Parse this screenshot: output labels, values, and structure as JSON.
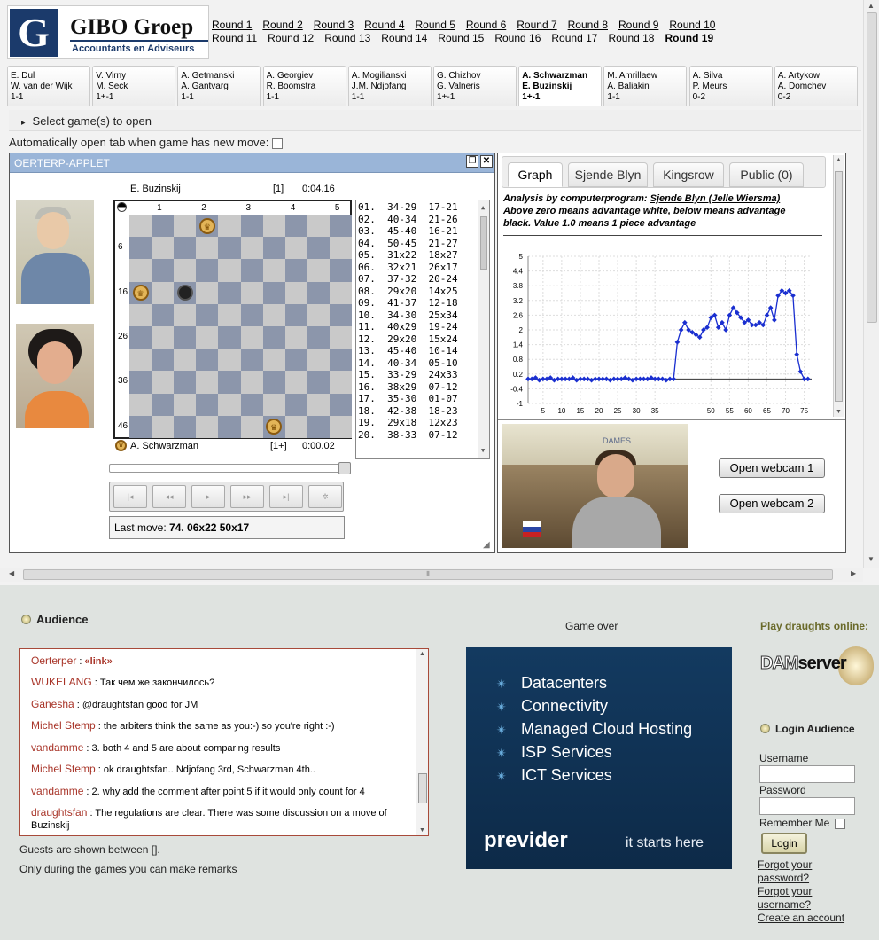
{
  "header": {
    "logo_letter": "G",
    "logo_name": "GIBO Groep",
    "logo_tagline": "Accountants en Adviseurs"
  },
  "rounds": [
    "Round 1",
    "Round 2",
    "Round 3",
    "Round 4",
    "Round 5",
    "Round 6",
    "Round 7",
    "Round 8",
    "Round 9",
    "Round 10",
    "Round 11",
    "Round 12",
    "Round 13",
    "Round 14",
    "Round 15",
    "Round 16",
    "Round 17",
    "Round 18",
    "Round 19"
  ],
  "current_round": "Round 19",
  "game_tabs": [
    {
      "white": "E. Dul",
      "black": "W. van der Wijk",
      "score": "1-1"
    },
    {
      "white": "V. Virny",
      "black": "M. Seck",
      "score": "1+-1"
    },
    {
      "white": "A. Getmanski",
      "black": "A. Gantvarg",
      "score": "1-1"
    },
    {
      "white": "A. Georgiev",
      "black": "R. Boomstra",
      "score": "1-1"
    },
    {
      "white": "A. Mogilianski",
      "black": "J.M. Ndjofang",
      "score": "1-1"
    },
    {
      "white": "G. Chizhov",
      "black": "G. Valneris",
      "score": "1+-1"
    },
    {
      "white": "A. Schwarzman",
      "black": "E. Buzinskij",
      "score": "1+-1"
    },
    {
      "white": "M. Amrillaew",
      "black": "A. Baliakin",
      "score": "1-1"
    },
    {
      "white": "A. Silva",
      "black": "P. Meurs",
      "score": "0-2"
    },
    {
      "white": "A. Artykow",
      "black": "A. Domchev",
      "score": "0-2"
    }
  ],
  "select_games_label": "Select game(s) to open",
  "auto_open_label": "Automatically open tab when game has new move:",
  "applet": {
    "title": "OERTERP-APPLET",
    "top_player": "E. Buzinskij",
    "top_score": "[1]",
    "top_clock": "0:04.16",
    "bottom_player": "A. Schwarzman",
    "bottom_score": "[1+]",
    "bottom_clock": "0:00.02",
    "col_labels": [
      "1",
      "2",
      "3",
      "4",
      "5"
    ],
    "row_labels": [
      "6",
      "16",
      "26",
      "36",
      "46"
    ],
    "moves": [
      "01.  34-29  17-21",
      "02.  40-34  21-26",
      "03.  45-40  16-21",
      "04.  50-45  21-27",
      "05.  31x22  18x27",
      "06.  32x21  26x17",
      "07.  37-32  20-24",
      "08.  29x20  14x25",
      "09.  41-37  12-18",
      "10.  34-30  25x34",
      "11.  40x29  19-24",
      "12.  29x20  15x24",
      "13.  45-40  10-14",
      "14.  40-34  05-10",
      "15.  33-29  24x33",
      "16.  38x29  07-12",
      "17.  35-30  01-07",
      "18.  42-38  18-23",
      "19.  29x18  12x23",
      "20.  38-33  07-12"
    ],
    "last_move_label": "Last move: ",
    "last_move_value": "74. 06x22 50x17",
    "pieces": [
      {
        "square": 2,
        "color": "white",
        "king": true
      },
      {
        "square": 16,
        "color": "white",
        "king": true
      },
      {
        "square": 17,
        "color": "black",
        "king": false
      },
      {
        "square": 49,
        "color": "white",
        "king": true
      }
    ],
    "controls": [
      "first-icon",
      "prev-icon",
      "play-icon",
      "next-icon",
      "last-icon",
      "settings-icon"
    ],
    "control_glyphs": [
      "|◂",
      "◂◂",
      "▸",
      "▸▸",
      "▸|",
      "✲"
    ]
  },
  "right_tabs": [
    "Graph",
    "Sjende Blyn",
    "Kingsrow",
    "Public (0)"
  ],
  "analysis": {
    "prefix": "Analysis by computerprogram: ",
    "program_link": "Sjende Blyn (Jelle Wiersma)",
    "line2": "Above zero means advantage white, below means advantage",
    "line3": "black. Value 1.0 means 1 piece advantage"
  },
  "webcam_buttons": [
    "Open webcam 1",
    "Open webcam 2"
  ],
  "webcam_photo_banner": "DAMES",
  "audience": {
    "title": "Audience",
    "messages": [
      {
        "user": "Oerterper",
        "text": "«link»",
        "is_link": true
      },
      {
        "user": "WUKELANG",
        "text": "Так чем же закончилось?"
      },
      {
        "user": "Ganesha",
        "text": "@draughtsfan good for JM"
      },
      {
        "user": "Michel Stemp",
        "text": "the arbiters think the same as you:-) so you're right :-)"
      },
      {
        "user": "vandamme",
        "text": "3. both 4 and 5 are about comparing results"
      },
      {
        "user": "Michel Stemp",
        "text": "ok draughtsfan.. Ndjofang 3rd, Schwarzman 4th.."
      },
      {
        "user": "vandamme",
        "text": "2. why add the comment after point 5 if it would only count for 4"
      },
      {
        "user": "draughtsfan",
        "text": "The regulations are clear. There was some discussion on a move of Buzinskij"
      }
    ],
    "guests_note": "Guests are shown between [].",
    "remarks_note": "Only during the games you can make remarks"
  },
  "game_over": "Game over",
  "ad": {
    "items": [
      "Datacenters",
      "Connectivity",
      "Managed Cloud Hosting",
      "ISP Services",
      "ICT Services"
    ],
    "brand": "previder",
    "slogan": "it starts here"
  },
  "sidebar": {
    "play_link": "Play draughts online:",
    "dam_logo_a": "DAM",
    "dam_logo_b": "server",
    "login_title": "Login Audience",
    "username_label": "Username",
    "password_label": "Password",
    "remember_label": "Remember Me",
    "login_button": "Login",
    "forgot_password": [
      "Forgot your",
      "password?"
    ],
    "forgot_username": [
      "Forgot your",
      "username?"
    ],
    "create_account": "Create an account"
  },
  "chart_data": {
    "type": "line",
    "yticks": [
      5,
      4.4,
      3.8,
      3.2,
      2.6,
      2,
      1.4,
      0.8,
      0.2,
      -0.4,
      -1
    ],
    "xticks": [
      5,
      10,
      15,
      20,
      25,
      30,
      35,
      50,
      55,
      60,
      65,
      70,
      75
    ],
    "ylim": [
      -1,
      5
    ],
    "xlim": [
      1,
      77
    ],
    "x": [
      1,
      2,
      3,
      4,
      5,
      6,
      7,
      8,
      9,
      10,
      11,
      12,
      13,
      14,
      15,
      16,
      17,
      18,
      19,
      20,
      21,
      22,
      23,
      24,
      25,
      26,
      27,
      28,
      29,
      30,
      31,
      32,
      33,
      34,
      35,
      36,
      37,
      38,
      39,
      40,
      41,
      42,
      43,
      44,
      45,
      46,
      47,
      48,
      49,
      50,
      51,
      52,
      53,
      54,
      55,
      56,
      57,
      58,
      59,
      60,
      61,
      62,
      63,
      64,
      65,
      66,
      67,
      68,
      69,
      70,
      71,
      72,
      73,
      74,
      75,
      76
    ],
    "y": [
      0,
      0,
      0.05,
      -0.05,
      0,
      0,
      0.05,
      -0.05,
      0,
      0,
      0,
      0,
      0.05,
      -0.05,
      0,
      0,
      0,
      -0.05,
      0,
      0,
      0,
      0,
      -0.05,
      0,
      0,
      0,
      0.05,
      0,
      -0.05,
      0,
      0,
      0,
      0,
      0.05,
      0,
      0,
      0,
      -0.05,
      0,
      0,
      1.5,
      2,
      2.3,
      2.0,
      1.9,
      1.8,
      1.7,
      2.0,
      2.1,
      2.5,
      2.6,
      2.1,
      2.3,
      2.0,
      2.6,
      2.9,
      2.7,
      2.5,
      2.3,
      2.4,
      2.2,
      2.2,
      2.3,
      2.2,
      2.6,
      2.9,
      2.4,
      3.4,
      3.6,
      3.5,
      3.6,
      3.4,
      1.0,
      0.3,
      0,
      0
    ]
  }
}
